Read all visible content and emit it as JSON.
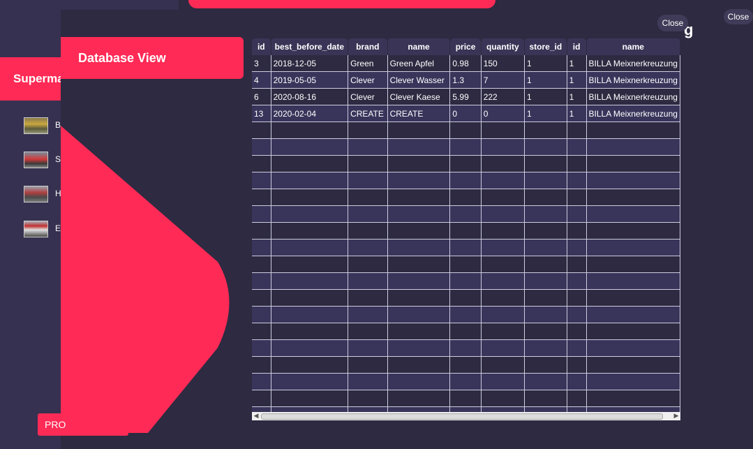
{
  "background_window": {
    "header_title": "Superma",
    "title_fragment": "g",
    "close_label": "Close",
    "pro_button_label": "PRO",
    "stores": [
      {
        "label": "B"
      },
      {
        "label": "S"
      },
      {
        "label": "H"
      },
      {
        "label": "E"
      }
    ]
  },
  "dialog": {
    "title": "Database View",
    "close_label": "Close"
  },
  "table": {
    "columns": [
      "id",
      "best_before_date",
      "brand",
      "name",
      "price",
      "quantity",
      "store_id",
      "id",
      "name"
    ],
    "rows": [
      [
        "3",
        "2018-12-05",
        "Green",
        "Green Apfel",
        "0.98",
        "150",
        "1",
        "1",
        "BILLA Meixnerkreuzung"
      ],
      [
        "4",
        "2019-05-05",
        "Clever",
        "Clever Wasser",
        "1.3",
        "7",
        "1",
        "1",
        "BILLA Meixnerkreuzung"
      ],
      [
        "6",
        "2020-08-16",
        "Clever",
        "Clever Kaese",
        "5.99",
        "222",
        "1",
        "1",
        "BILLA Meixnerkreuzung"
      ],
      [
        "13",
        "2020-02-04",
        "CREATE",
        "CREATE",
        "0",
        "0",
        "1",
        "1",
        "BILLA Meixnerkreuzung"
      ]
    ],
    "empty_row_count": 18
  },
  "colors": {
    "accent": "#ff2a55",
    "background": "#2d2a41",
    "row_alt": "#38345a",
    "header": "#3a3556"
  }
}
